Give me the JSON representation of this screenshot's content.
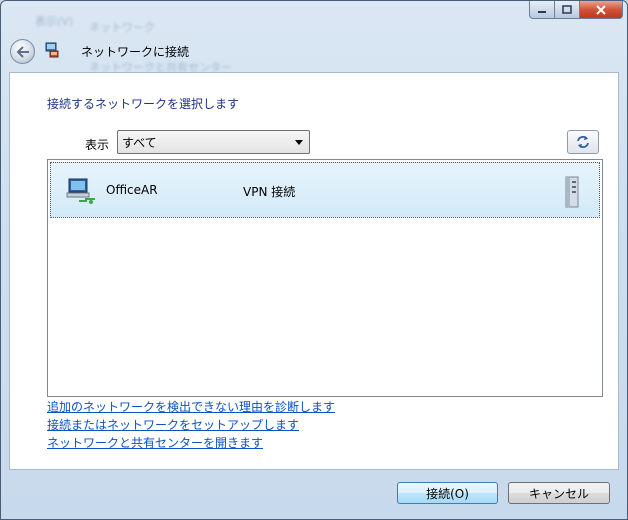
{
  "window": {
    "title": "ネットワークに接続",
    "background_ghost_texts": [
      "表示(V)",
      "ネットワーク",
      "ネットワークと共有センター"
    ]
  },
  "caption_buttons": {
    "minimize_icon": "minimize-icon",
    "maximize_icon": "maximize-icon",
    "close_icon": "close-icon"
  },
  "content": {
    "instruction": "接続するネットワークを選択します",
    "filter": {
      "label": "表示",
      "selected": "すべて"
    },
    "networks": [
      {
        "name": "OfficeAR",
        "type": "VPN 接続",
        "icon": "vpn-connection-icon",
        "signal_icon": "server-icon"
      }
    ],
    "links": {
      "diagnose": "追加のネットワークを検出できない理由を診断します",
      "setup": "接続またはネットワークをセットアップします",
      "center": "ネットワークと共有センターを開きます"
    }
  },
  "footer": {
    "connect_label": "接続(O)",
    "cancel_label": "キャンセル"
  },
  "colors": {
    "instruction_text": "#1e3287",
    "link": "#0c52c4",
    "selection_bg": "#d2eaf8"
  }
}
